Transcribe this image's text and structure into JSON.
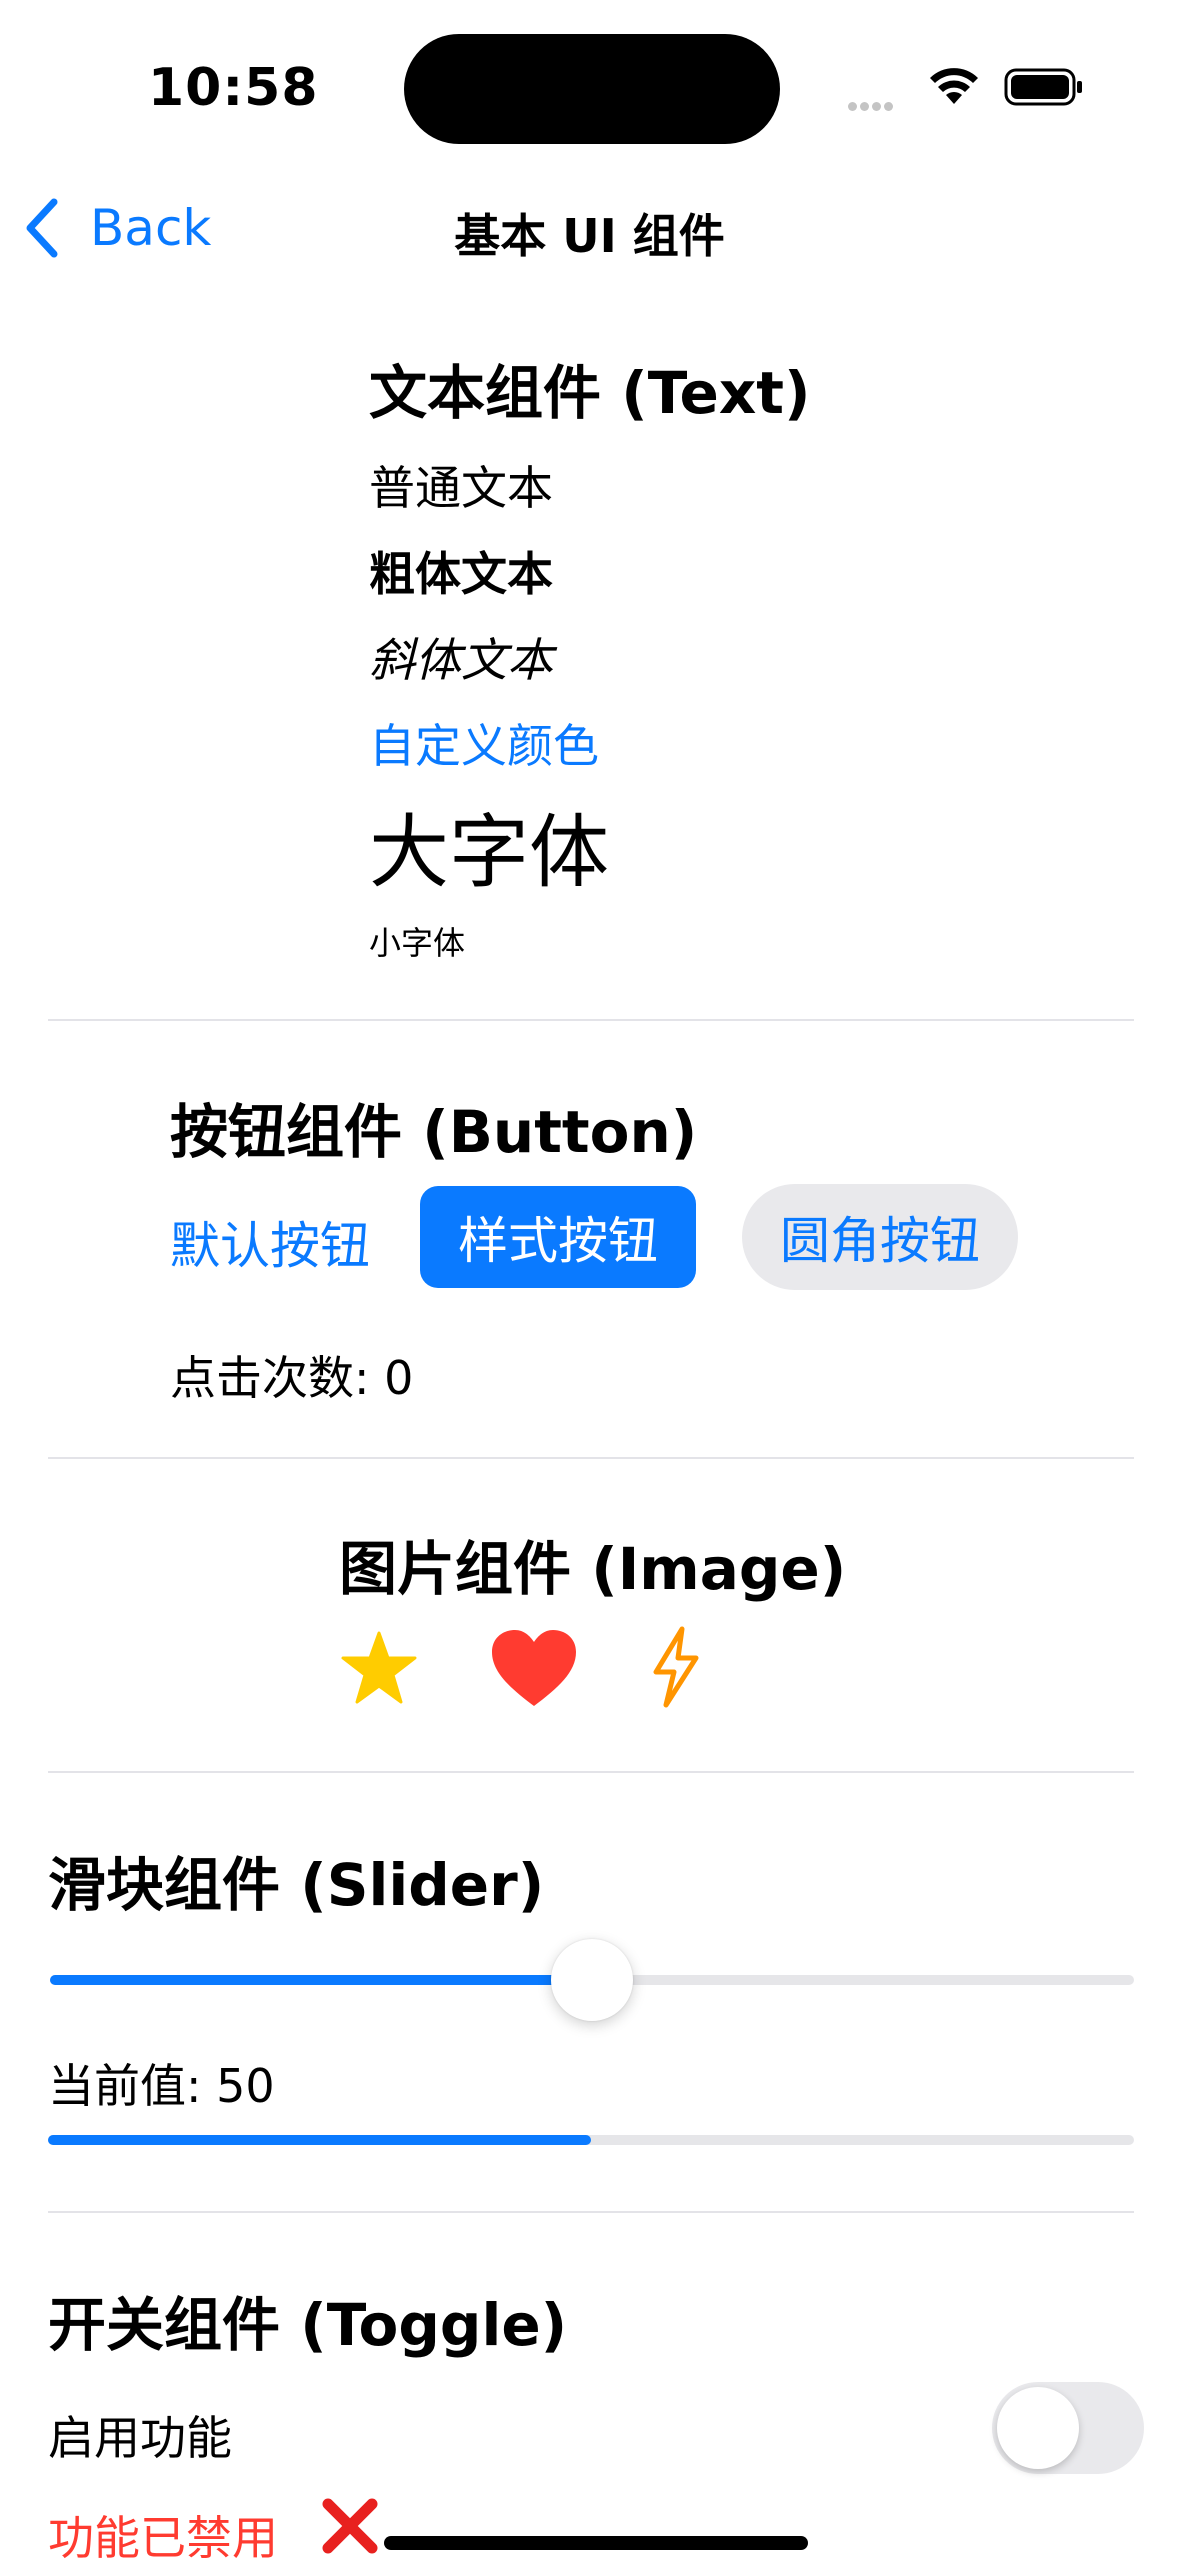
{
  "status_bar": {
    "time": "10:58"
  },
  "nav": {
    "back_label": "Back",
    "title": "基本 UI 组件"
  },
  "text_section": {
    "title": "文本组件 (Text)",
    "normal": "普通文本",
    "bold": "粗体文本",
    "italic": "斜体文本",
    "colored": "自定义颜色",
    "large": "大字体",
    "small": "小字体"
  },
  "button_section": {
    "title": "按钮组件 (Button)",
    "default_button": "默认按钮",
    "styled_button": "样式按钮",
    "rounded_button": "圆角按钮",
    "click_count": "点击次数: 0"
  },
  "image_section": {
    "title": "图片组件 (Image)",
    "icons": [
      "star-icon",
      "heart-icon",
      "bolt-icon"
    ]
  },
  "slider_section": {
    "title": "滑块组件 (Slider)",
    "value": 50,
    "min": 0,
    "max": 100,
    "value_label": "当前值: 50",
    "progress": 0.5
  },
  "toggle_section": {
    "title": "开关组件 (Toggle)",
    "toggle_label": "启用功能",
    "is_on": false,
    "status_text": "功能已禁用"
  },
  "colors": {
    "accent": "#0a7aff",
    "star": "#ffcc00",
    "heart": "#ff3b30",
    "bolt": "#ff9500",
    "disabled_text": "#ff3b30"
  }
}
